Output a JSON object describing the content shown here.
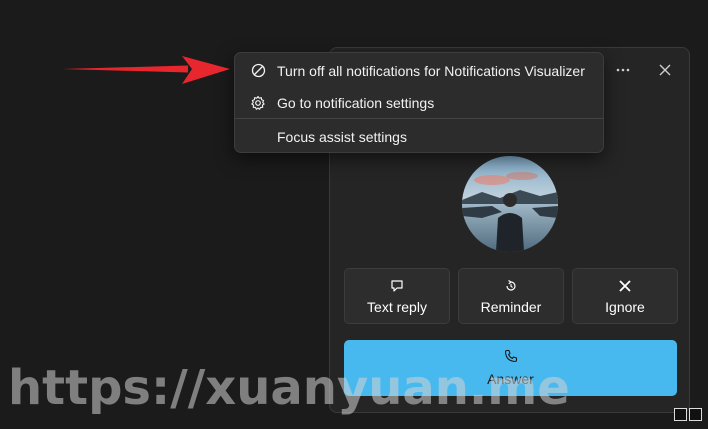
{
  "context_menu": {
    "items": [
      {
        "icon": "block-icon",
        "label": "Turn off all notifications for Notifications Visualizer"
      },
      {
        "icon": "gear-icon",
        "label": "Go to notification settings"
      },
      {
        "icon": "",
        "label": "Focus assist settings"
      }
    ]
  },
  "toast": {
    "controls": {
      "more": "more-options-icon",
      "close": "close-icon"
    },
    "actions": [
      {
        "icon": "chat-bubble-icon",
        "label": "Text reply"
      },
      {
        "icon": "alarm-snooze-icon",
        "label": "Reminder"
      },
      {
        "icon": "x-icon",
        "label": "Ignore"
      }
    ],
    "answer": {
      "icon": "phone-icon",
      "label": "Answer"
    }
  },
  "watermark": {
    "text": "https://xuanyuan.me"
  },
  "colors": {
    "answer": "#48b9ef",
    "arrow": "#e8262d",
    "background": "#1b1b1b",
    "toast": "#252525"
  }
}
